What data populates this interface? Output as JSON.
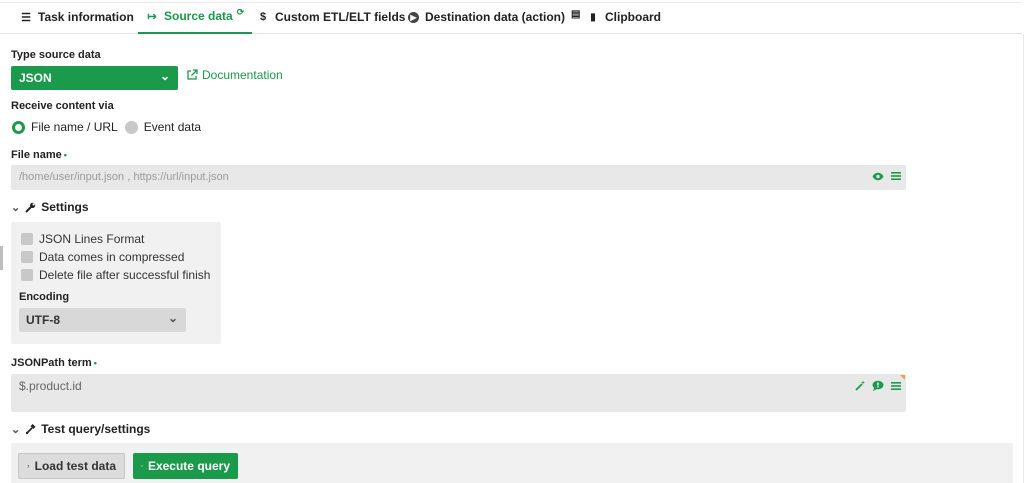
{
  "tabs": [
    {
      "label": "Task information",
      "icon": "list-icon",
      "glyph": "☰"
    },
    {
      "label": "Source data",
      "icon": "import-icon",
      "glyph": "↦",
      "extra_glyph": "⟳"
    },
    {
      "label": "Custom ETL/ELT fields",
      "icon": "dollar-icon",
      "glyph": "$"
    },
    {
      "label": "Destination data (action)",
      "icon": "play-circle-icon",
      "glyph": "▶",
      "extra_glyph": "▤"
    },
    {
      "label": "Clipboard",
      "icon": "clipboard-icon",
      "glyph": "▮"
    }
  ],
  "source": {
    "type_label": "Type source data",
    "type_value": "JSON",
    "doc_link": "Documentation",
    "receive_label": "Receive content via",
    "radio_options": [
      "File name / URL",
      "Event data"
    ],
    "selected_radio": "File name / URL"
  },
  "file": {
    "label": "File name",
    "required_mark": "•",
    "placeholder": "/home/user/input.json , https://url/input.json"
  },
  "settings": {
    "toggle_label": "Settings",
    "checkboxes": [
      "JSON Lines Format",
      "Data comes in compressed",
      "Delete file after successful finish"
    ],
    "encoding_label": "Encoding",
    "encoding_value": "UTF-8"
  },
  "jsonpath": {
    "label": "JSONPath term",
    "required_mark": "•",
    "value": "$.product.id"
  },
  "test": {
    "toggle_label": "Test query/settings",
    "load_button": "Load test data",
    "execute_button": "Execute query"
  },
  "colors": {
    "accent": "#1a9a4a",
    "field_bg": "#e8e8e8",
    "panel_bg": "#f1f1f1"
  }
}
